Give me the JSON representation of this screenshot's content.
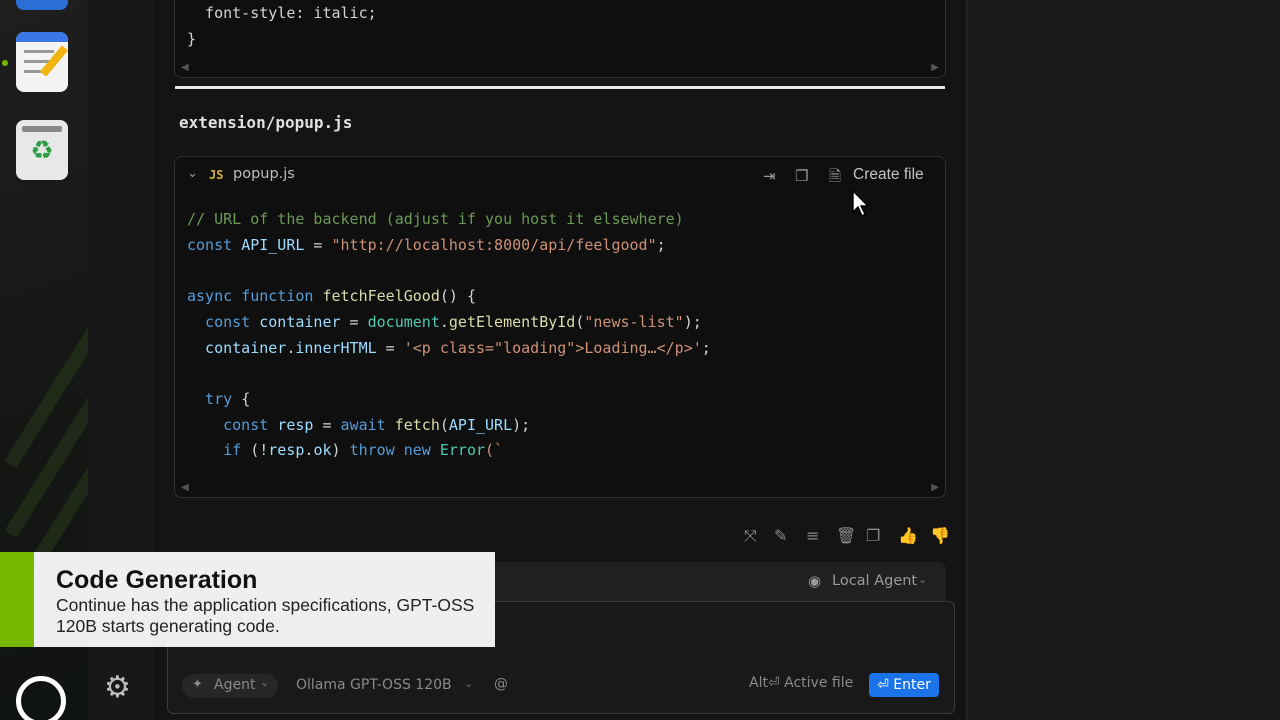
{
  "top_block": {
    "lines": [
      [
        {
          "t": "  font-style: italic;",
          "c": "c-txt"
        }
      ],
      [
        {
          "t": "}",
          "c": "c-txt"
        }
      ]
    ]
  },
  "section": {
    "filename": "extension/popup.js"
  },
  "code_header": {
    "lang_badge": "JS",
    "file": "popup.js",
    "create_file_label": "Create file"
  },
  "code_lines": [
    [
      {
        "t": "// URL of the backend (adjust if you host it elsewhere)",
        "c": "c-com"
      }
    ],
    [
      {
        "t": "const ",
        "c": "c-kw"
      },
      {
        "t": "API_URL",
        "c": "c-var"
      },
      {
        "t": " = ",
        "c": "c-txt"
      },
      {
        "t": "\"http://localhost:8000/api/feelgood\"",
        "c": "c-str"
      },
      {
        "t": ";",
        "c": "c-txt"
      }
    ],
    [],
    [
      {
        "t": "async ",
        "c": "c-kw"
      },
      {
        "t": "function ",
        "c": "c-kw"
      },
      {
        "t": "fetchFeelGood",
        "c": "c-fn"
      },
      {
        "t": "() {",
        "c": "c-txt"
      }
    ],
    [
      {
        "t": "  const ",
        "c": "c-kw"
      },
      {
        "t": "container",
        "c": "c-var"
      },
      {
        "t": " = ",
        "c": "c-txt"
      },
      {
        "t": "document",
        "c": "c-obj"
      },
      {
        "t": ".",
        "c": "c-txt"
      },
      {
        "t": "getElementById",
        "c": "c-fn"
      },
      {
        "t": "(",
        "c": "c-txt"
      },
      {
        "t": "\"news-list\"",
        "c": "c-str"
      },
      {
        "t": ");",
        "c": "c-txt"
      }
    ],
    [
      {
        "t": "  container",
        "c": "c-var"
      },
      {
        "t": ".",
        "c": "c-txt"
      },
      {
        "t": "innerHTML",
        "c": "c-var"
      },
      {
        "t": " = ",
        "c": "c-txt"
      },
      {
        "t": "'<p class=\"loading\">Loading…</p>'",
        "c": "c-str"
      },
      {
        "t": ";",
        "c": "c-txt"
      }
    ],
    [],
    [
      {
        "t": "  try ",
        "c": "c-kw"
      },
      {
        "t": "{",
        "c": "c-txt"
      }
    ],
    [
      {
        "t": "    const ",
        "c": "c-kw"
      },
      {
        "t": "resp",
        "c": "c-var"
      },
      {
        "t": " = ",
        "c": "c-txt"
      },
      {
        "t": "await ",
        "c": "c-kw"
      },
      {
        "t": "fetch",
        "c": "c-fn"
      },
      {
        "t": "(",
        "c": "c-txt"
      },
      {
        "t": "API_URL",
        "c": "c-var"
      },
      {
        "t": ");",
        "c": "c-txt"
      }
    ],
    [
      {
        "t": "    if ",
        "c": "c-kw"
      },
      {
        "t": "(!",
        "c": "c-txt"
      },
      {
        "t": "resp",
        "c": "c-var"
      },
      {
        "t": ".",
        "c": "c-txt"
      },
      {
        "t": "ok",
        "c": "c-var"
      },
      {
        "t": ") ",
        "c": "c-txt"
      },
      {
        "t": "throw ",
        "c": "c-kw"
      },
      {
        "t": "new ",
        "c": "c-kw"
      },
      {
        "t": "Error",
        "c": "c-obj"
      },
      {
        "t": "(`",
        "c": "c-str"
      }
    ]
  ],
  "input": {
    "agent_selector": "Local Agent",
    "mode": "Agent",
    "model": "Ollama GPT-OSS 120B",
    "at_symbol": "@",
    "hint": "Alt⏎ Active file",
    "enter_label": "⏎ Enter"
  },
  "caption": {
    "title": "Code Generation",
    "body": "Continue has the application specifications, GPT-OSS 120B starts generating code."
  },
  "colors": {
    "accent": "#76b900",
    "enter": "#1a73e8"
  }
}
